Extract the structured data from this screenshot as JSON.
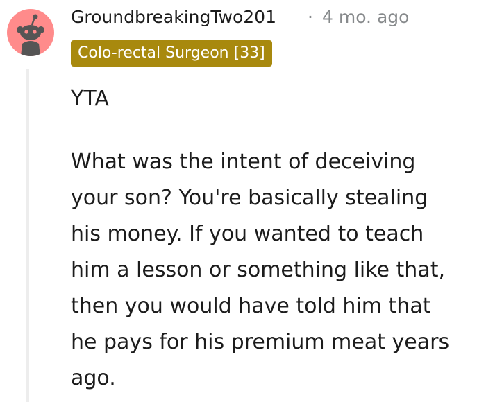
{
  "comment": {
    "author": "GroundbreakingTwo201",
    "separator": "·",
    "timestamp": "4 mo. ago",
    "flair": "Colo-rectal Surgeon [33]",
    "body": {
      "verdict": "YTA",
      "lines": [
        "What was the intent of deceiving",
        "your son? You're basically stealing",
        "his money. If you wanted to teach",
        "him a lesson or something like that,",
        "then you would have told him that",
        "he pays for his premium meat years",
        "ago."
      ]
    }
  },
  "colors": {
    "avatar_bg": "#ff8b8b",
    "avatar_figure": "#555555",
    "flair_bg": "#a8890e",
    "flair_text": "#ffffff",
    "meta_text": "#878a8c",
    "thread_line": "#ededed"
  },
  "icons": {
    "avatar": "snoo-avatar-icon"
  }
}
